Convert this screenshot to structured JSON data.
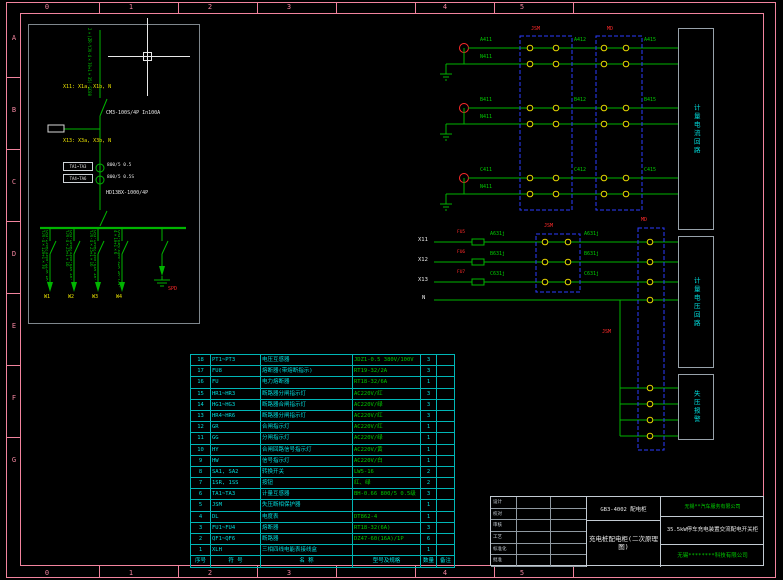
{
  "colors": {
    "frame_pink": "#f2849e",
    "wire_green": "#00b400",
    "label_green": "#00cc00",
    "cyan": "#00dcdc",
    "yellow": "#e8d800",
    "red": "#ff2a2a",
    "dashed_blue": "#2b3cff",
    "white": "#e8e8e8",
    "device_box_grey": "#98a2aa"
  },
  "frame": {
    "top_numbers": [
      "0",
      "1",
      "2",
      "3",
      "4",
      "5"
    ],
    "bottom_numbers": [
      "0",
      "1",
      "2",
      "3",
      "4",
      "5"
    ],
    "row_letters": [
      "A",
      "B",
      "C",
      "D",
      "E",
      "F",
      "G"
    ]
  },
  "incoming": {
    "cable_spec": "2×(ZR-YJV-4×70+1×35)-SC80",
    "terminal_note_top": "X11: X1a, X1b, N",
    "main_breaker": "CM3-100S/4P In100A",
    "terminal_note_mid": "X13: X3a, X3b, N",
    "ct_row1_label": "TA1~TA3",
    "ct_row1_spec": "800/5 0.5",
    "ct_row2_label": "TA4~TA6",
    "ct_row2_spec": "800/5 0.5S",
    "main_switch": "HD13BX-1000/4P"
  },
  "feeders": [
    {
      "spec": "CM3-250M/3300-225A ZR-YJV-4×120+1×70",
      "label": "W1"
    },
    {
      "spec": "CM3-100M/3300-63A ZR-YJV-4×25+1×16",
      "label": "W2"
    },
    {
      "spec": "CM3-100M/3300-63A ZR-YJV-4×25+1×16",
      "label": "W3"
    },
    {
      "spec": "CM3-63M/3300-32A ZR-YJV-4×10+1×6",
      "label": "W4"
    }
  ],
  "spd_label": "SPD",
  "metering_current": {
    "box_label": "计量电流回路",
    "jsm_label": "JSM",
    "md_label": "MD",
    "phases": [
      {
        "in": "A411",
        "mid": "A412",
        "out": "A415",
        "n": "N411"
      },
      {
        "in": "B411",
        "mid": "B412",
        "out": "B415",
        "n": "N411"
      },
      {
        "in": "C411",
        "mid": "C412",
        "out": "C415",
        "n": "N411"
      }
    ]
  },
  "metering_voltage": {
    "box_label": "计量电压回路",
    "jsm_label": "JSM",
    "md_label": "MD",
    "relay_label": "JSM",
    "rows": [
      {
        "term": "X11",
        "fuse": "FU5",
        "wire": "A631j"
      },
      {
        "term": "X12",
        "fuse": "FU6",
        "wire": "B631j"
      },
      {
        "term": "X13",
        "fuse": "FU7",
        "wire": "C631j"
      },
      {
        "term": "N",
        "fuse": "",
        "wire": ""
      }
    ]
  },
  "alarm": {
    "box_label": "失压报警"
  },
  "bom": {
    "headers": [
      "序号",
      "符 号",
      "名 称",
      "型号及规格",
      "数量",
      "备注"
    ],
    "rows": [
      {
        "no": "18",
        "sym": "PT1~PT3",
        "name": "电压互感器",
        "model": "JDZ1-0.5 380V/100V",
        "qty": "3",
        "note": ""
      },
      {
        "no": "17",
        "sym": "FU8",
        "name": "熔断器(带熔断指示)",
        "model": "RT19-32/2A",
        "qty": "3",
        "note": ""
      },
      {
        "no": "16",
        "sym": "FU",
        "name": "电力熔断器",
        "model": "RT18-32/6A",
        "qty": "1",
        "note": ""
      },
      {
        "no": "15",
        "sym": "HR1~HR3",
        "name": "断路器分闸指示灯",
        "model": "AC220V/红",
        "qty": "3",
        "note": ""
      },
      {
        "no": "14",
        "sym": "HG1~HG3",
        "name": "断路器合闸指示灯",
        "model": "AC220V/绿",
        "qty": "3",
        "note": ""
      },
      {
        "no": "13",
        "sym": "HR4~HR6",
        "name": "断路器分闸指示灯",
        "model": "AC220V/红",
        "qty": "3",
        "note": ""
      },
      {
        "no": "12",
        "sym": "GR",
        "name": "合闸指示灯",
        "model": "AC220V/红",
        "qty": "1",
        "note": ""
      },
      {
        "no": "11",
        "sym": "GG",
        "name": "分闸指示灯",
        "model": "AC220V/绿",
        "qty": "1",
        "note": ""
      },
      {
        "no": "10",
        "sym": "HY",
        "name": "合闸回路信号指示灯",
        "model": "AC220V/黄",
        "qty": "1",
        "note": ""
      },
      {
        "no": "9",
        "sym": "HW",
        "name": "信号指示灯",
        "model": "AC220V/白",
        "qty": "1",
        "note": ""
      },
      {
        "no": "8",
        "sym": "SA1, SA2",
        "name": "转换开关",
        "model": "LW5-16",
        "qty": "2",
        "note": ""
      },
      {
        "no": "7",
        "sym": "1SR, 1SS",
        "name": "按钮",
        "model": "红、绿",
        "qty": "2",
        "note": ""
      },
      {
        "no": "6",
        "sym": "TA1~TA3",
        "name": "计量互感器",
        "model": "BH-0.66 800/5 0.5级",
        "qty": "3",
        "note": ""
      },
      {
        "no": "5",
        "sym": "JSM",
        "name": "失压断相保护器",
        "model": "",
        "qty": "1",
        "note": ""
      },
      {
        "no": "4",
        "sym": "DL",
        "name": "电度表",
        "model": "DT862-4",
        "qty": "1",
        "note": ""
      },
      {
        "no": "3",
        "sym": "FU1~FU4",
        "name": "熔断器",
        "model": "RT18-32(6A)",
        "qty": "3",
        "note": ""
      },
      {
        "no": "2",
        "sym": "QF1~QF6",
        "name": "断路器",
        "model": "DZ47-60(16A)/1P",
        "qty": "6",
        "note": ""
      },
      {
        "no": "1",
        "sym": "XLH",
        "name": "三相四线电能表接线盒",
        "model": "",
        "qty": "1",
        "note": ""
      }
    ]
  },
  "title_block": {
    "product_code": "GB3-4002 配电柜",
    "drawing_title": "充电桩配电柜(二次原理图)",
    "customer": "无锡**汽车服务有限公司",
    "project": "35.5kW停车充电装置交流配电开关柜",
    "company": "无锡********科技有限公司",
    "sign_labels": [
      "设计",
      "校对",
      "审核",
      "工艺",
      "标准化",
      "批准"
    ]
  }
}
